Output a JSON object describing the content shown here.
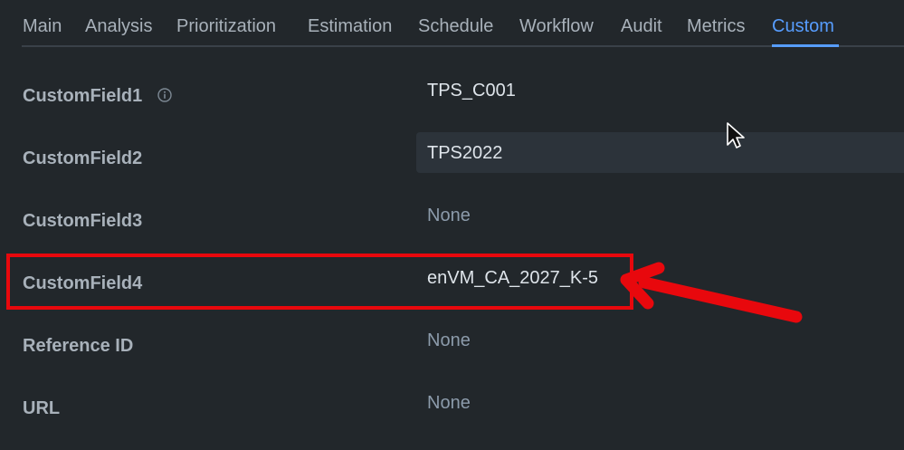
{
  "tabs": [
    {
      "label": "Main"
    },
    {
      "label": "Analysis"
    },
    {
      "label": "Prioritization"
    },
    {
      "label": "Estimation"
    },
    {
      "label": "Schedule"
    },
    {
      "label": "Workflow"
    },
    {
      "label": "Audit"
    },
    {
      "label": "Metrics"
    },
    {
      "label": "Custom",
      "active": true
    }
  ],
  "fields": [
    {
      "label": "CustomField1",
      "value": "TPS_C001",
      "icon": "info-icon"
    },
    {
      "label": "CustomField2",
      "value": "TPS2022",
      "hovered": true
    },
    {
      "label": "CustomField3",
      "value": "None"
    },
    {
      "label": "CustomField4",
      "value": "enVM_CA_2027_K-5",
      "highlighted": true
    },
    {
      "label": "Reference ID",
      "value": "None"
    },
    {
      "label": "URL",
      "value": "None"
    }
  ],
  "colors": {
    "background": "#22272b",
    "accent": "#579dff",
    "label": "#a8b1ba",
    "value": "#dee4ea",
    "annotation": "#e8080d"
  }
}
